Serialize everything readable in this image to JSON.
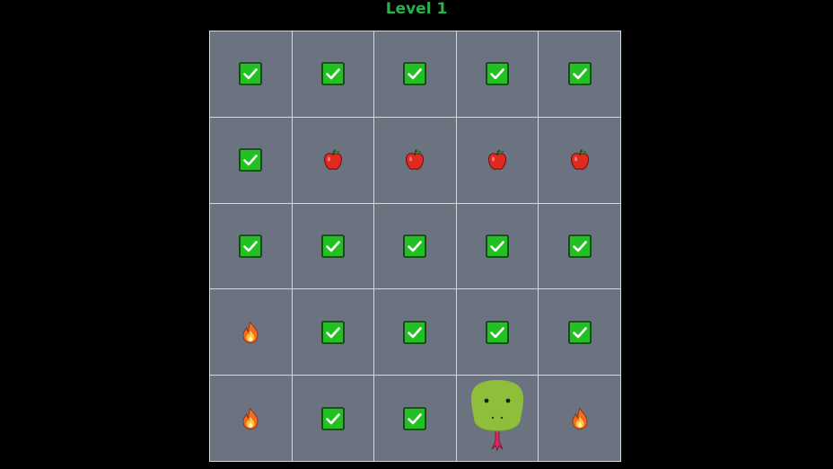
{
  "title": "Level 1",
  "colors": {
    "background": "#000000",
    "cell": "#6b7280",
    "grid_line": "#d5d8de",
    "title": "#2bb24c",
    "check_fill": "#22c022",
    "snake": "#8fbf3a",
    "tongue": "#e0245e"
  },
  "board": {
    "rows": 5,
    "cols": 5,
    "cells": [
      [
        "check",
        "check",
        "check",
        "check",
        "check"
      ],
      [
        "check",
        "apple",
        "apple",
        "apple",
        "apple"
      ],
      [
        "check",
        "check",
        "check",
        "check",
        "check"
      ],
      [
        "fire",
        "check",
        "check",
        "check",
        "check"
      ],
      [
        "fire",
        "check",
        "check",
        "snake-head",
        "fire"
      ]
    ]
  }
}
